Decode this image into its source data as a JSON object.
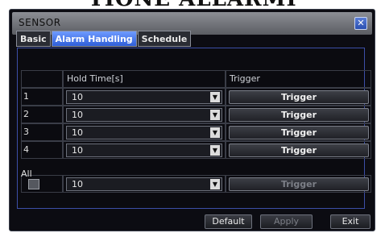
{
  "heading": "TIONE ALLARMI",
  "window": {
    "title": "SENSOR",
    "close_symbol": "✕"
  },
  "tabs": [
    {
      "label": "Basic",
      "active": false
    },
    {
      "label": "Alarm Handling",
      "active": true
    },
    {
      "label": "Schedule",
      "active": false
    }
  ],
  "table": {
    "headers": {
      "index": "",
      "hold_time": "Hold Time[s]",
      "trigger": "Trigger"
    },
    "rows": [
      {
        "index": "1",
        "hold_time": "10",
        "trigger_label": "Trigger"
      },
      {
        "index": "2",
        "hold_time": "10",
        "trigger_label": "Trigger"
      },
      {
        "index": "3",
        "hold_time": "10",
        "trigger_label": "Trigger"
      },
      {
        "index": "4",
        "hold_time": "10",
        "trigger_label": "Trigger"
      }
    ],
    "all": {
      "label": "All",
      "hold_time": "10",
      "trigger_label": "Trigger",
      "checked": false
    }
  },
  "footer": {
    "default_label": "Default",
    "apply_label": "Apply",
    "exit_label": "Exit"
  },
  "colors": {
    "accent": "#2f5ed8",
    "panel_border": "#3c4fa8",
    "background": "#0c0c12"
  },
  "icons": {
    "close": "close-icon",
    "dropdown": "chevron-down-icon"
  }
}
